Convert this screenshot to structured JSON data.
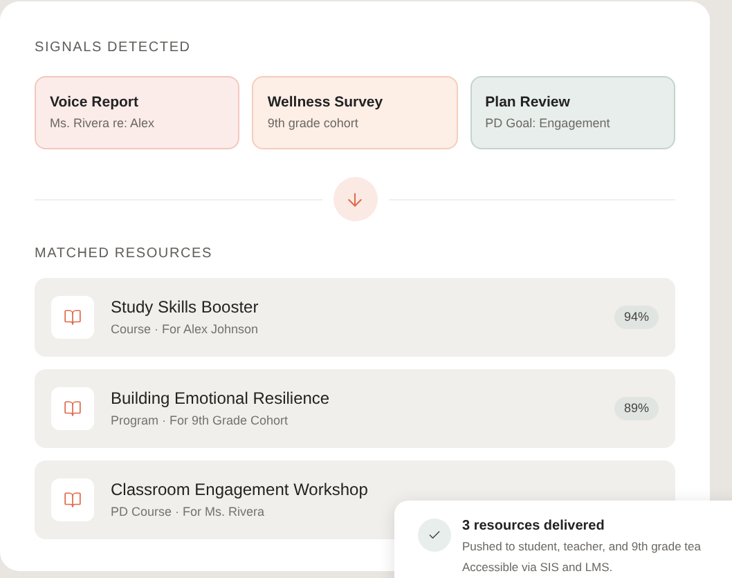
{
  "signals": {
    "heading": "SIGNALS DETECTED",
    "items": [
      {
        "title": "Voice Report",
        "subtitle": "Ms. Rivera re: Alex",
        "color": "#fbecea"
      },
      {
        "title": "Wellness Survey",
        "subtitle": "9th grade cohort",
        "color": "#fdeee6"
      },
      {
        "title": "Plan Review",
        "subtitle": "PD Goal: Engagement",
        "color": "#e8eeeb"
      }
    ]
  },
  "resources": {
    "heading": "MATCHED RESOURCES",
    "items": [
      {
        "title": "Study Skills Booster",
        "subtitle": "Course · For Alex Johnson",
        "match": "94%"
      },
      {
        "title": "Building Emotional Resilience",
        "subtitle": "Program · For 9th Grade Cohort",
        "match": "89%"
      },
      {
        "title": "Classroom Engagement Workshop",
        "subtitle": "PD Course · For Ms. Rivera"
      }
    ]
  },
  "toast": {
    "title": "3 resources delivered",
    "lines": [
      "Pushed to student, teacher, and 9th grade tea",
      "Accessible via SIS and LMS."
    ]
  }
}
